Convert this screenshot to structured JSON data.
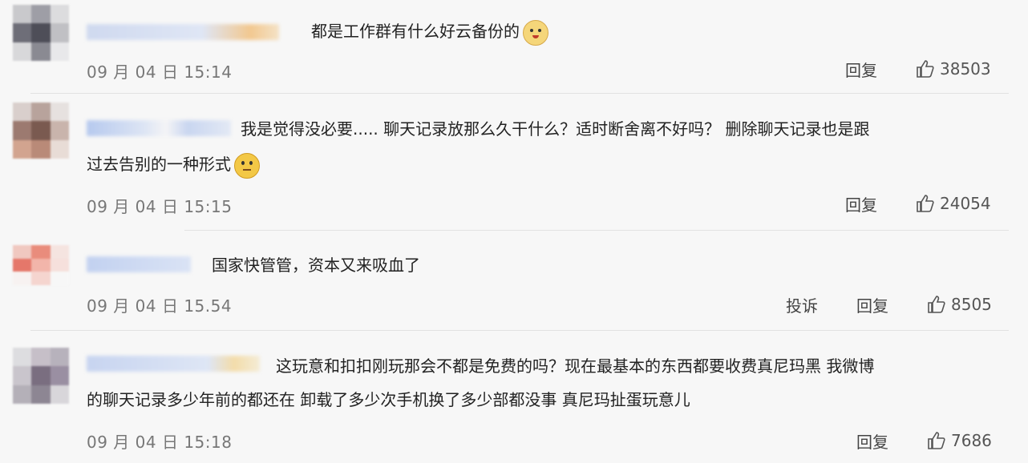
{
  "comments": [
    {
      "text_lines": [
        "都是工作群有什么好云备份的"
      ],
      "date": "09 月 04 日 15:14",
      "reply_label": "回复",
      "likes": "38503",
      "emoji": "dog-emoji"
    },
    {
      "text_lines": [
        "我是觉得没必要.....  聊天记录放那么久干什么？适时断舍离不好吗？ 删除聊天记录也是跟",
        "过去告别的一种形式"
      ],
      "date": "09 月 04 日 15:15",
      "reply_label": "回复",
      "likes": "24054",
      "emoji": "thinking-face-emoji"
    },
    {
      "text_lines": [
        "国家快管管，资本又来吸血了"
      ],
      "date": "09 月 04 日 15.54",
      "report_label": "投诉",
      "reply_label": "回复",
      "likes": "8505"
    },
    {
      "text_lines": [
        "这玩意和扣扣刚玩那会不都是免费的吗？现在最基本的东西都要收费真尼玛黑 我微博",
        "的聊天记录多少年前的都还在 卸载了多少次手机换了多少部都没事 真尼玛扯蛋玩意儿"
      ],
      "date": "09 月 04 日 15:18",
      "reply_label": "回复",
      "likes": "7686"
    }
  ]
}
